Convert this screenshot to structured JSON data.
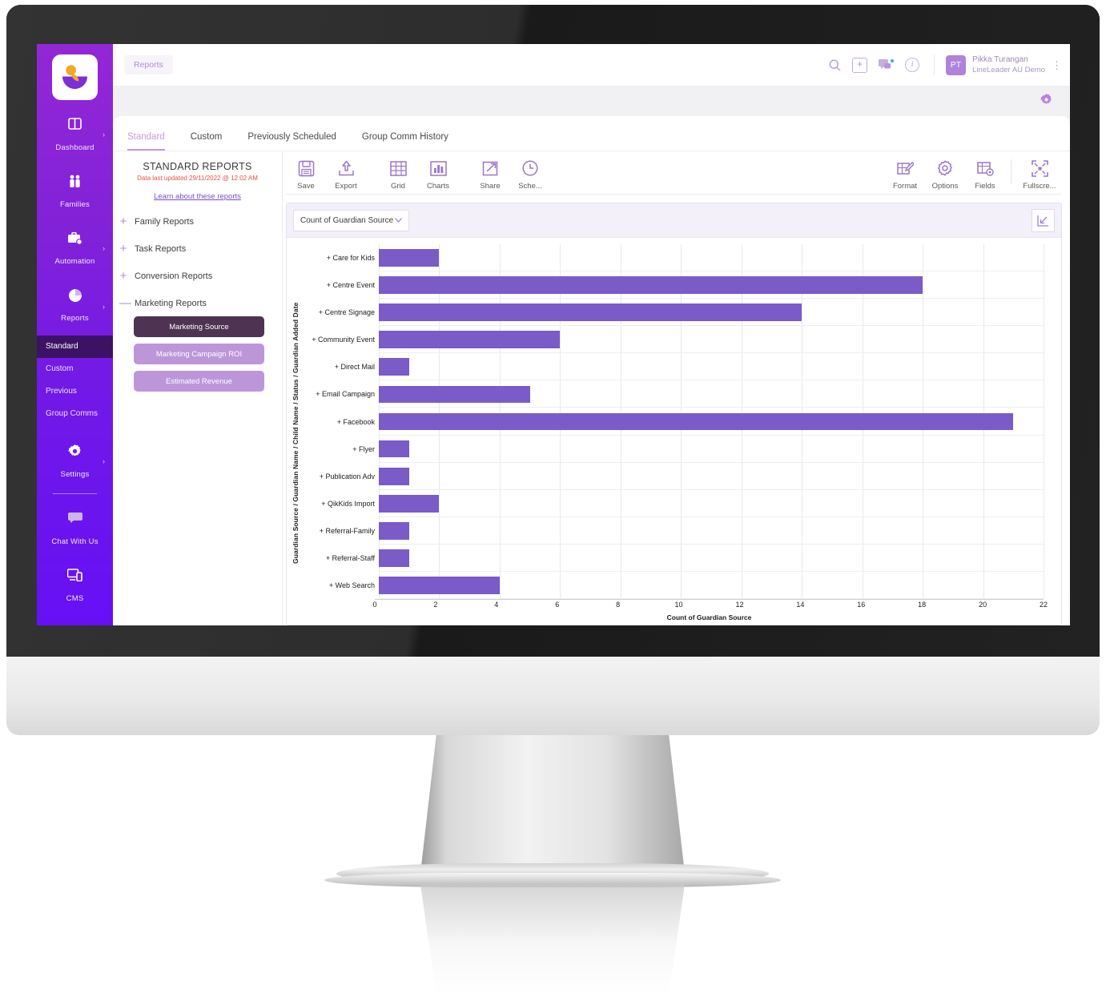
{
  "sidebar": {
    "logo_name": "lineleader-logo",
    "items": [
      {
        "label": "Dashboard",
        "icon": "dashboard-icon",
        "chevron": true
      },
      {
        "label": "Families",
        "icon": "families-icon",
        "chevron": false
      },
      {
        "label": "Automation",
        "icon": "automation-icon",
        "chevron": true
      },
      {
        "label": "Reports",
        "icon": "reports-icon",
        "chevron": true
      }
    ],
    "sub_items": [
      {
        "label": "Standard",
        "active": true
      },
      {
        "label": "Custom",
        "active": false
      },
      {
        "label": "Previous",
        "active": false
      },
      {
        "label": "Group Comms",
        "active": false
      }
    ],
    "bottom_items": [
      {
        "label": "Settings",
        "icon": "gear-icon",
        "chevron": true
      },
      {
        "label": "Chat With Us",
        "icon": "chat-icon",
        "chevron": false
      },
      {
        "label": "CMS",
        "icon": "cms-icon",
        "chevron": false
      }
    ]
  },
  "topbar": {
    "breadcrumb": "Reports",
    "user_initials": "PT",
    "user_name": "Pikka Turangan",
    "user_org": "LineLeader AU Demo",
    "icons": [
      "search-icon",
      "plus-icon",
      "chat-bubbles-icon",
      "info-icon",
      "kebab-menu-icon"
    ]
  },
  "page_gear": "settings-gear-icon",
  "tabs": [
    {
      "label": "Standard",
      "active": true
    },
    {
      "label": "Custom",
      "active": false
    },
    {
      "label": "Previously Scheduled",
      "active": false
    },
    {
      "label": "Group Comm History",
      "active": false
    }
  ],
  "left_panel": {
    "title": "STANDARD REPORTS",
    "subtitle": "Data last updated 29/11/2022 @ 12:02 AM",
    "link": "Learn about these reports",
    "groups": [
      {
        "label": "Family Reports",
        "sign": "+"
      },
      {
        "label": "Task Reports",
        "sign": "+"
      },
      {
        "label": "Conversion Reports",
        "sign": "+"
      },
      {
        "label": "Marketing Reports",
        "sign": "—"
      }
    ],
    "reports": [
      {
        "label": "Marketing Source",
        "selected": true
      },
      {
        "label": "Marketing Campaign ROI",
        "selected": false
      },
      {
        "label": "Estimated Revenue",
        "selected": false
      }
    ]
  },
  "toolbar": {
    "left": [
      {
        "label": "Save",
        "icon": "save-disk-icon"
      },
      {
        "label": "Export",
        "icon": "export-upload-icon"
      },
      {
        "label": "Grid",
        "icon": "grid-table-icon"
      },
      {
        "label": "Charts",
        "icon": "bar-chart-icon"
      },
      {
        "label": "Share",
        "icon": "share-external-icon"
      },
      {
        "label": "Sche...",
        "icon": "clock-schedule-icon"
      }
    ],
    "right": [
      {
        "label": "Format",
        "icon": "format-pencil-icon"
      },
      {
        "label": "Options",
        "icon": "options-gear-icon"
      },
      {
        "label": "Fields",
        "icon": "fields-table-gear-icon"
      },
      {
        "label": "Fullscre...",
        "icon": "fullscreen-expand-icon"
      }
    ]
  },
  "chart_toolbar": {
    "measure_select": "Count of Guardian Source",
    "chevron": "chevron-down-icon",
    "resize_icon": "collapse-arrow-icon"
  },
  "colors": {
    "bar": "#7b5bc7",
    "sidebar_top": "#9327d6",
    "sidebar_bottom": "#6610f5",
    "accent": "#b48ad8",
    "selected_report": "#4e3352",
    "alt_report": "#bd96da",
    "alert_text": "#e8523f"
  },
  "chart_data": {
    "type": "bar",
    "orientation": "horizontal",
    "title": "",
    "xlabel": "Count of Guardian Source",
    "ylabel": "Guardian Source / Guardian Name / Child Name / Status / Guardian Added Date",
    "xlim": [
      0,
      22
    ],
    "xticks": [
      0,
      2,
      4,
      6,
      8,
      10,
      12,
      14,
      16,
      18,
      20,
      22
    ],
    "grid": true,
    "legend": "none",
    "categories": [
      "+ Care for Kids",
      "+ Centre Event",
      "+ Centre Signage",
      "+ Community Event",
      "+ Direct Mail",
      "+ Email Campaign",
      "+ Facebook",
      "+ Flyer",
      "+ Publication Adv",
      "+ QikKids Import",
      "+ Referral-Family",
      "+ Referral-Staff",
      "+ Web Search"
    ],
    "values": [
      2,
      18,
      14,
      6,
      1,
      5,
      21,
      1,
      1,
      2,
      1,
      1,
      4
    ]
  }
}
